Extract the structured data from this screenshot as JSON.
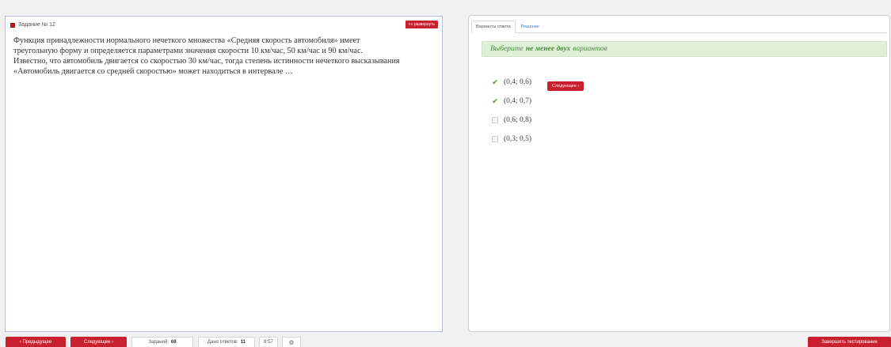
{
  "question": {
    "header": "Задание № 12",
    "expand_label": "«« развернуть",
    "text": "Функция принадлежности нормального нечеткого множества «Средняя скорость автомобиля» имеет\nтреугольную форму и определяется параметрами значения скорости 10 км/час, 50 км/час и 90 км/час.\nИзвестно, что автомобиль двигается со скоростью 30 км/час, тогда степень истинности нечеткого высказывания\n«Автомобиль двигается со средней скоростью» может находиться в интервале …"
  },
  "answer": {
    "tabs": [
      {
        "label": "Варианты ответа",
        "active": true
      },
      {
        "label": "Решение",
        "active": false
      }
    ],
    "hint_prefix": "Выберите",
    "hint_bold": "не менее двух",
    "hint_suffix": "вариантов",
    "options": [
      {
        "label": "(0,4; 0,6)",
        "checked": true
      },
      {
        "label": "(0,4; 0,7)",
        "checked": true
      },
      {
        "label": "(0,6; 0,8)",
        "checked": false
      },
      {
        "label": "(0,3; 0,5)",
        "checked": false
      }
    ],
    "next_inline_label": "Следующее ›"
  },
  "footer": {
    "prev_label": "‹ Предыдущее",
    "next_label": "Следующее ›",
    "tasks_label": "Заданий:",
    "tasks_count": "68",
    "answered_label": "Дано ответов:",
    "answered_count": "11",
    "timer": "6:57",
    "finish_label": "Завершить тестирование"
  },
  "colors": {
    "accent_red": "#c8202f",
    "hint_green_bg": "#dff0d8",
    "hint_green_text": "#4a8a3c",
    "check_green": "#6aa84f"
  },
  "icons": {
    "gear": "gear-icon",
    "checkmark": "checkmark-icon"
  }
}
